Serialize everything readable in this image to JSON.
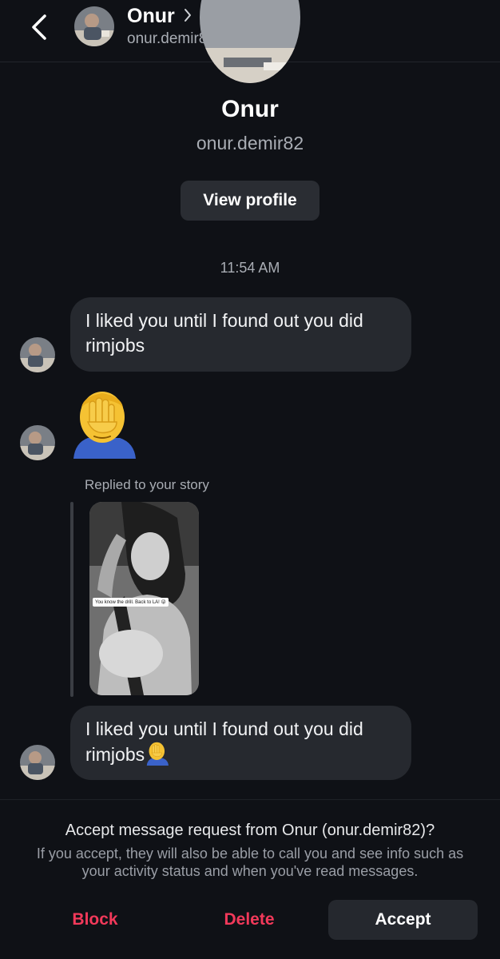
{
  "header": {
    "name": "Onur",
    "username": "onur.demir82"
  },
  "profile": {
    "name": "Onur",
    "username": "onur.demir82",
    "view_profile_label": "View profile"
  },
  "thread": {
    "timestamp": "11:54 AM",
    "message_1": "I liked you until I found out you did rimjobs",
    "replied_label": "Replied to your story",
    "story_caption": "You know the drill. Back to LA! 😜",
    "message_2": "I liked you until I found out you did rimjobs"
  },
  "request": {
    "title": "Accept message request from Onur (onur.demir82)?",
    "subtitle": "If you accept, they will also be able to call you and see info such as your activity status and when you've read messages.",
    "block_label": "Block",
    "delete_label": "Delete",
    "accept_label": "Accept"
  },
  "icons": {
    "back": "back-arrow-icon",
    "chevron": "chevron-right-icon",
    "facepalm": "facepalm-emoji"
  },
  "colors": {
    "background": "#0f1116",
    "bubble": "#26292f",
    "danger": "#f2395a",
    "secondary_text": "#a9adb4"
  }
}
